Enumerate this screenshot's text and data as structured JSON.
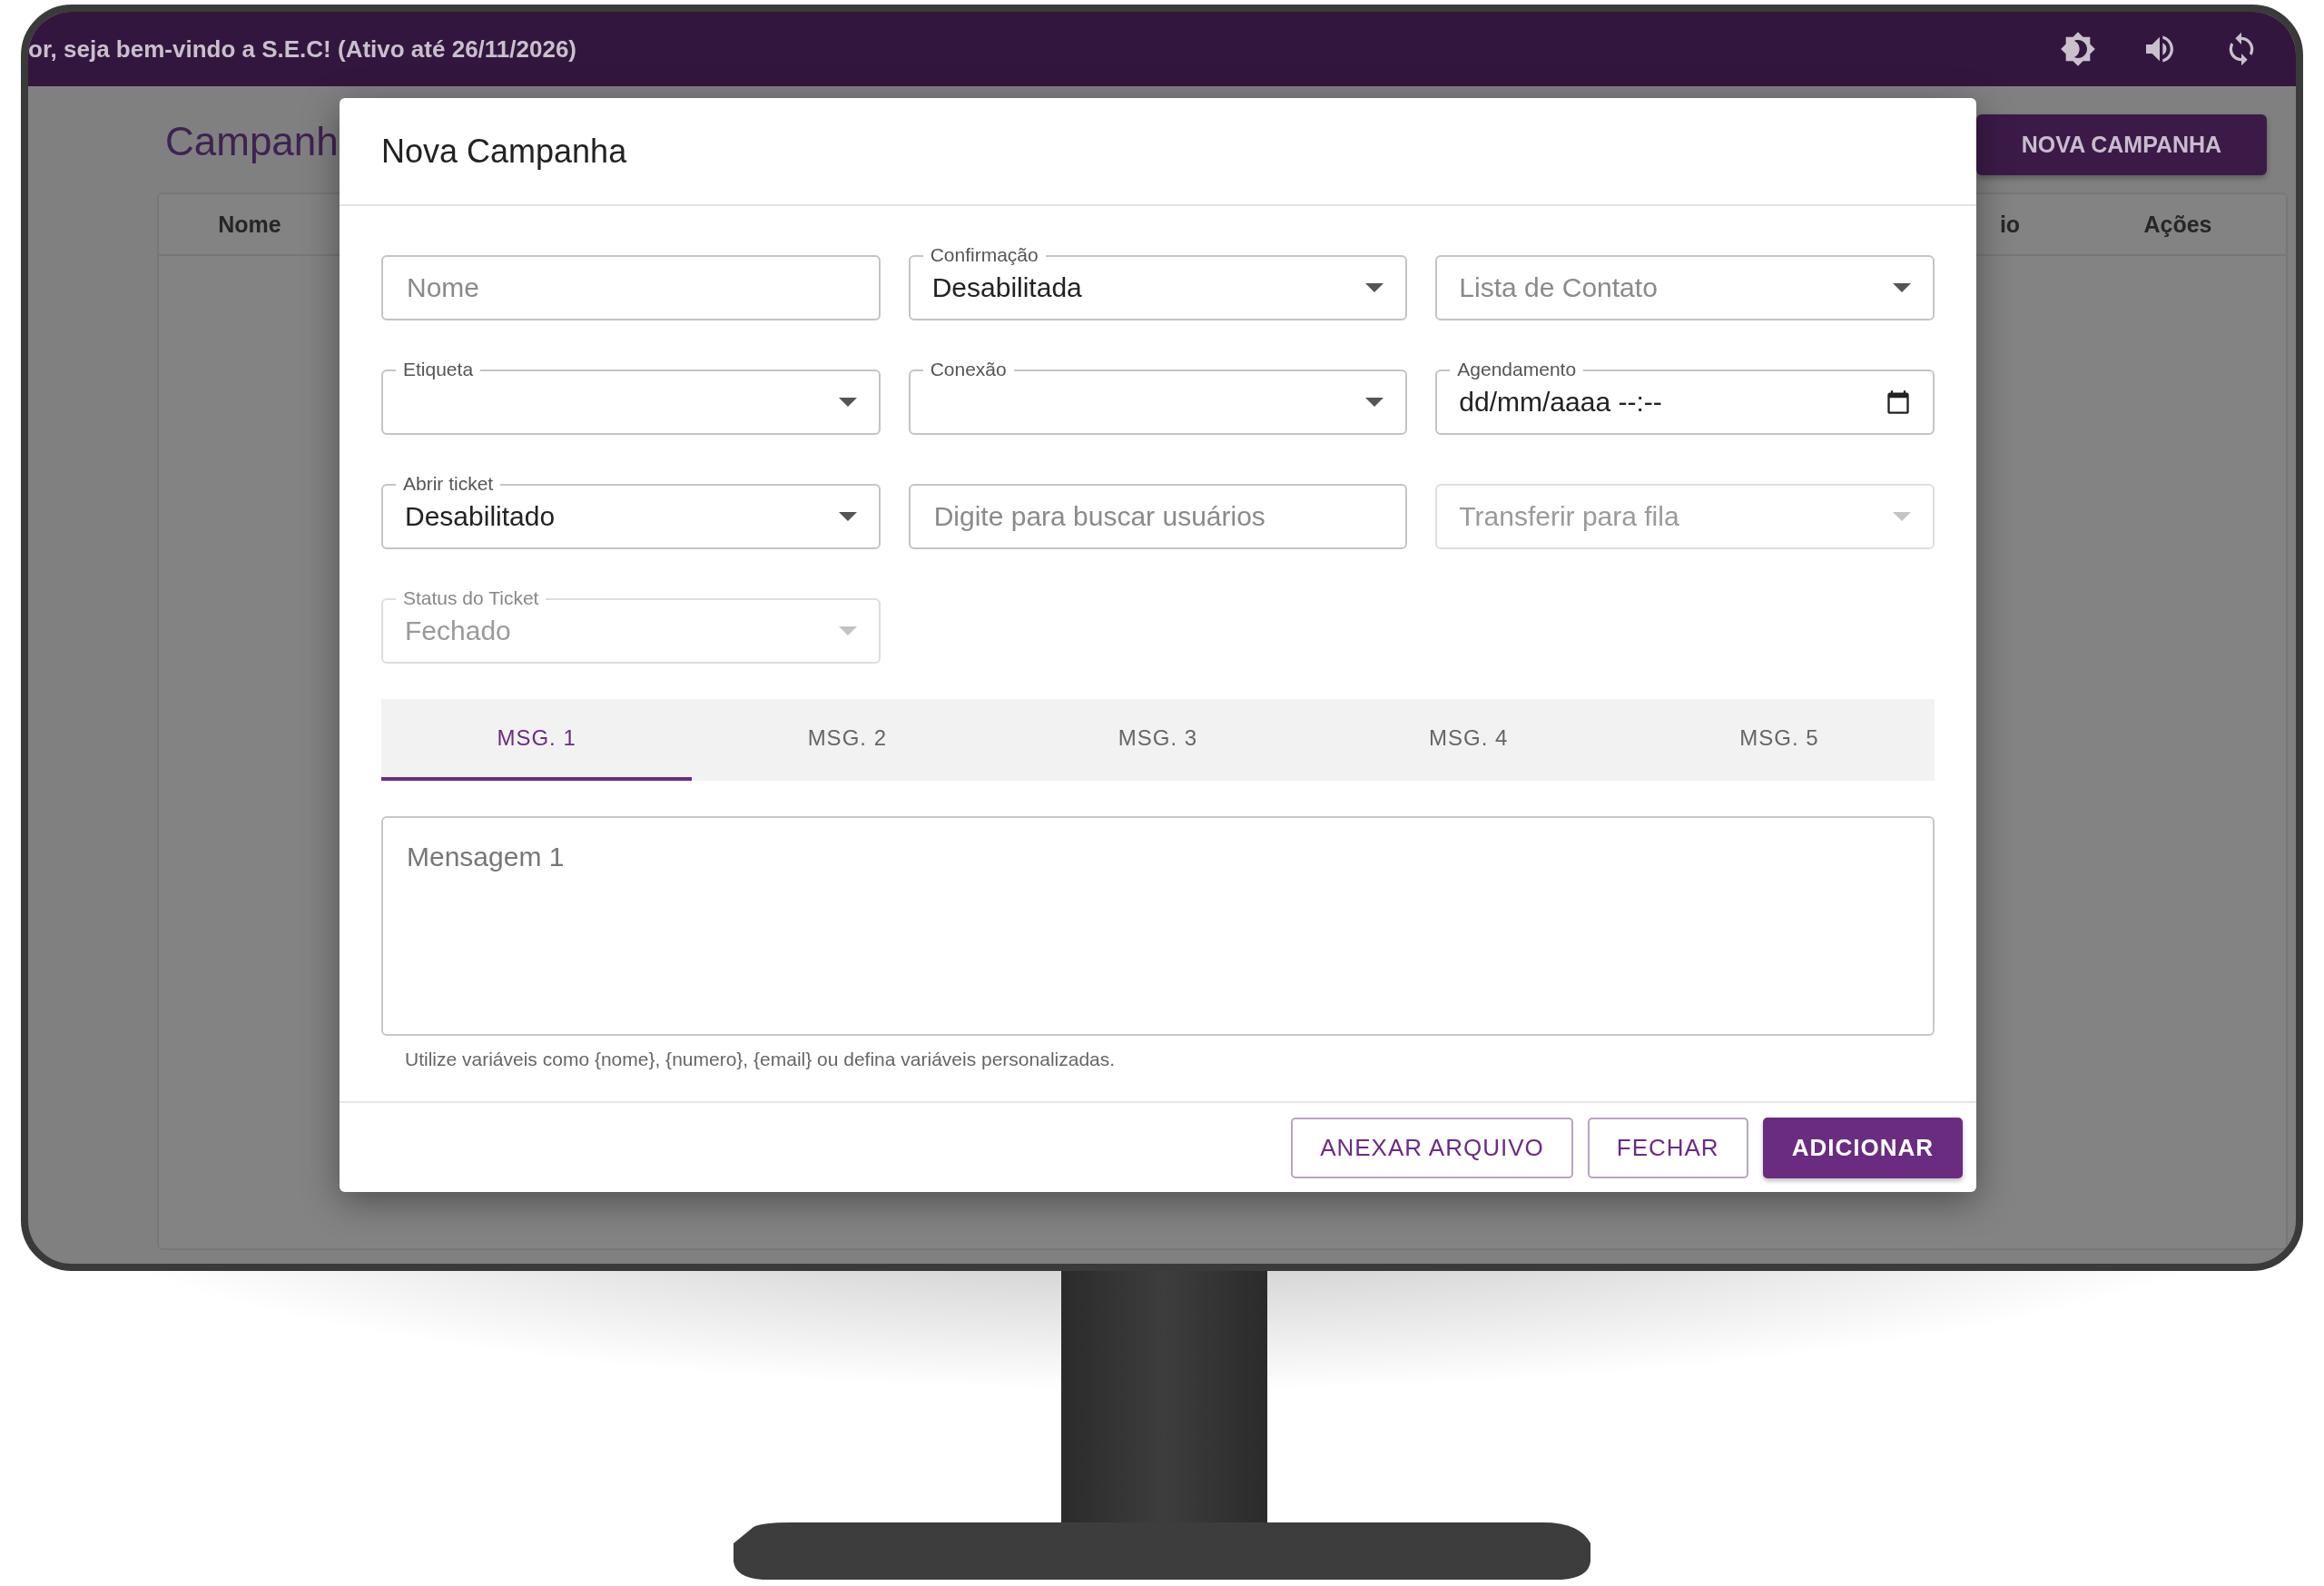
{
  "topbar": {
    "greeting": "or, seja bem-vindo a S.E.C! (Ativo até 26/11/2026)"
  },
  "page": {
    "title": "Campanh",
    "new_button": "NOVA CAMPANHA",
    "table": {
      "columns": [
        "Nome",
        "io",
        "Ações"
      ]
    }
  },
  "dialog": {
    "title": "Nova Campanha",
    "fields": [
      {
        "kind": "text",
        "placeholder": "Nome",
        "disabled": false
      },
      {
        "kind": "select",
        "label": "Confirmação",
        "value": "Desabilitada",
        "disabled": false
      },
      {
        "kind": "select",
        "placeholder": "Lista de Contato",
        "disabled": false
      },
      {
        "kind": "select",
        "label": "Etiqueta",
        "disabled": false
      },
      {
        "kind": "select",
        "label": "Conexão",
        "disabled": false
      },
      {
        "kind": "datetime",
        "label": "Agendamento",
        "value": "dd/mm/aaaa --:--",
        "disabled": false
      },
      {
        "kind": "select",
        "label": "Abrir ticket",
        "value": "Desabilitado",
        "disabled": false
      },
      {
        "kind": "text",
        "placeholder": "Digite para buscar usuários",
        "disabled": false
      },
      {
        "kind": "select",
        "placeholder": "Transferir para fila",
        "disabled": true
      },
      {
        "kind": "select",
        "label": "Status do Ticket",
        "value": "Fechado",
        "disabled": true
      }
    ],
    "tabs": [
      {
        "label": "MSG. 1",
        "selected": true
      },
      {
        "label": "MSG. 2",
        "selected": false
      },
      {
        "label": "MSG. 3",
        "selected": false
      },
      {
        "label": "MSG. 4",
        "selected": false
      },
      {
        "label": "MSG. 5",
        "selected": false
      }
    ],
    "message": {
      "placeholder": "Mensagem 1",
      "helper": "Utilize variáveis como {nome}, {numero}, {email} ou defina variáveis personalizadas."
    },
    "buttons": [
      {
        "label": "ANEXAR ARQUIVO",
        "kind": "outlined"
      },
      {
        "label": "FECHAR",
        "kind": "outlined"
      },
      {
        "label": "ADICIONAR",
        "kind": "contained"
      }
    ]
  }
}
